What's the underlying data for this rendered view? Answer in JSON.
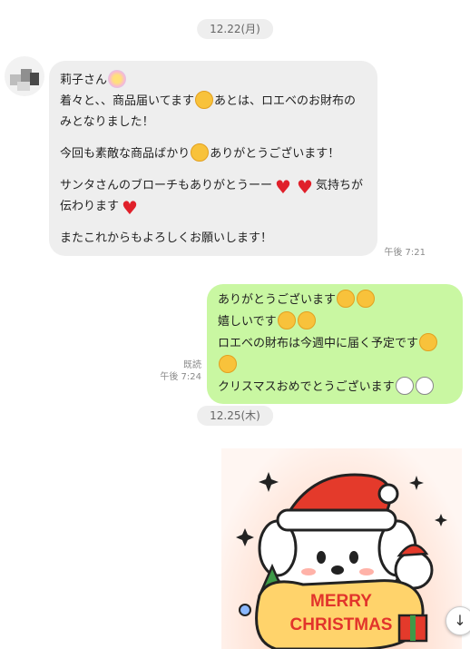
{
  "dates": {
    "first": "12.22(月)",
    "second": "12.25(木)"
  },
  "incoming": {
    "lines": [
      "莉子さん",
      "着々と、、商品届いてます",
      "あとは、ロエベのお財布のみとなりました！",
      "今回も素敵な商品ばかり",
      "ありがとうございます！",
      "サンタさんのブローチもありがとうーー",
      "気持ちが伝わります",
      "またこれからもよろしくお願いします！"
    ],
    "time": "午後 7:21"
  },
  "outgoing": {
    "lines": [
      "ありがとうございます",
      "嬉しいです",
      "ロエベの財布は今週中に届く予定です",
      "クリスマスおめでとうございます"
    ],
    "read_label": "既読",
    "time": "午後 7:24"
  },
  "sticker": {
    "text_line1": "MERRY",
    "text_line2": "CHRISTMAS"
  },
  "icons": {
    "scroll_down": "arrow-down-icon",
    "scroll_down_glyph": "↓"
  },
  "colors": {
    "incoming_bubble": "#eeeeee",
    "outgoing_bubble": "#c9f7a2",
    "date_pill": "#eeeeee",
    "sticker_text": "#e2342b"
  }
}
